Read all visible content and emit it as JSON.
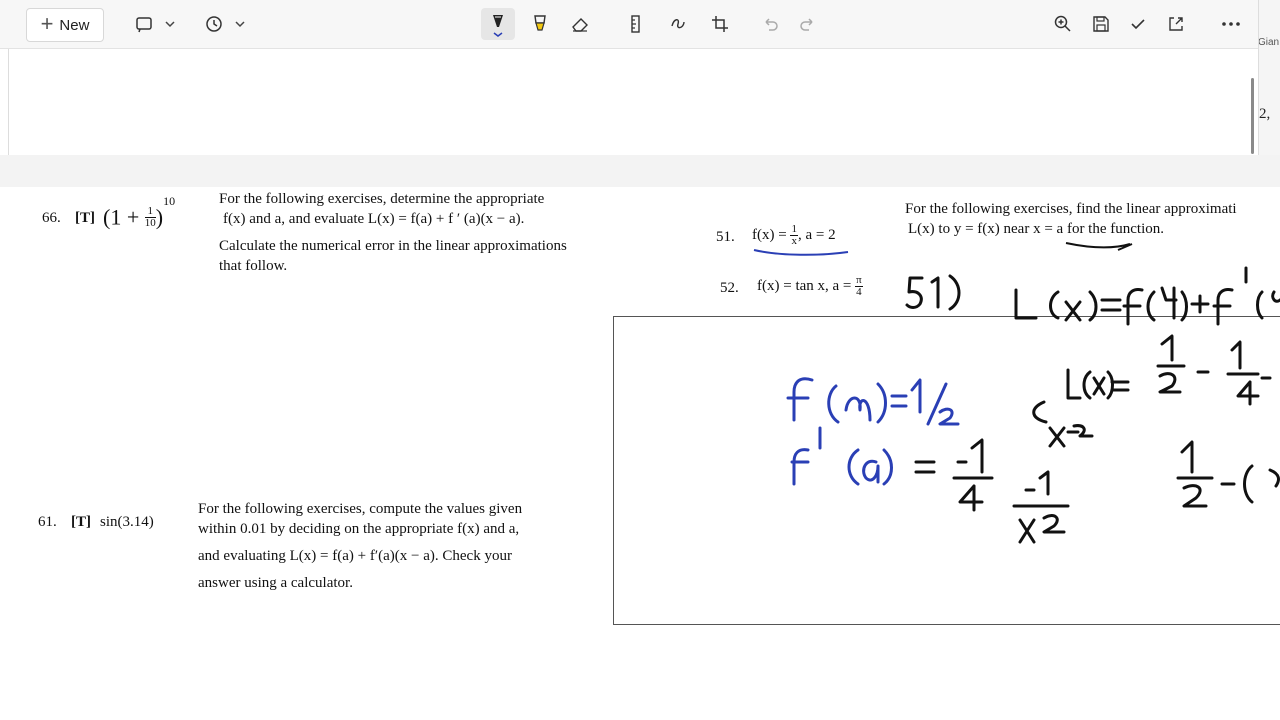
{
  "toolbar": {
    "new_label": "New",
    "plus_glyph": "+",
    "icons": [
      "shape-select-icon",
      "chevron-down-icon",
      "history-icon",
      "chevron-down-icon",
      "ballpoint-pen-icon",
      "highlighter-icon",
      "eraser-icon",
      "ruler-icon",
      "touch-writing-icon",
      "crop-icon",
      "undo-icon",
      "redo-icon",
      "zoom-icon",
      "save-icon",
      "checkmark-icon",
      "share-icon",
      "more-options-icon"
    ]
  },
  "side_peek": {
    "name_fragment": "Gian",
    "text_fragment": "2,"
  },
  "upper_block": {
    "num": "66.",
    "tag": "[T]",
    "expr": {
      "open": "(1 + ",
      "num": "1",
      "den": "10",
      "close": ")",
      "exp": "10"
    },
    "intro_l1": "For  the  following  exercises,  determine  the  appropriate",
    "intro_l2": "f(x)  and  a,   and evaluate  L(x) = f(a) + f ′ (a)(x − a).",
    "intro_l3": "Calculate the numerical error in the linear approximations",
    "intro_l4": "that follow."
  },
  "lower_block": {
    "num": "61.",
    "tag": "[T]",
    "expr": "sin(3.14)",
    "l1": "For  the  following  exercises,  compute  the  values  given",
    "l2": "within 0.01 by deciding on the appropriate   f(x)   and   a,",
    "l3": "and  evaluating   L(x) = f(a) + f′(a)(x − a).   Check  your",
    "l4": "answer using a calculator."
  },
  "right_block": {
    "intro_l1": "For the following exercises, find the linear approximati",
    "intro_l2": "L(x)   to   y = f(x)   near   x = a   for the function.",
    "ex51_num": "51.",
    "ex51_pre": "f(x) = ",
    "ex51_num_frac": "1",
    "ex51_den_frac": "x",
    "ex51_post": ", a = 2",
    "ex52_num": "52.",
    "ex52_pre": "f(x) = tan x,  a = ",
    "ex52_num_frac": "π",
    "ex52_den_frac": "4"
  },
  "ink": {
    "black_color": "#111111",
    "blue_color": "#2a3fb5",
    "black_label": "51)",
    "black_formula": "L(x)=f(a)+f'(a",
    "black_lx": "L(x)=",
    "black_half": "1/2",
    "black_minus_quarter": "- 1/4",
    "black_xminus": "x-2",
    "black_neg_one_over_x2": "-1/x²",
    "black_half_minus": "1/2 - (",
    "blue_fa": "f(a)= 1/2",
    "blue_fprime": "f'(a) = -1/4"
  }
}
